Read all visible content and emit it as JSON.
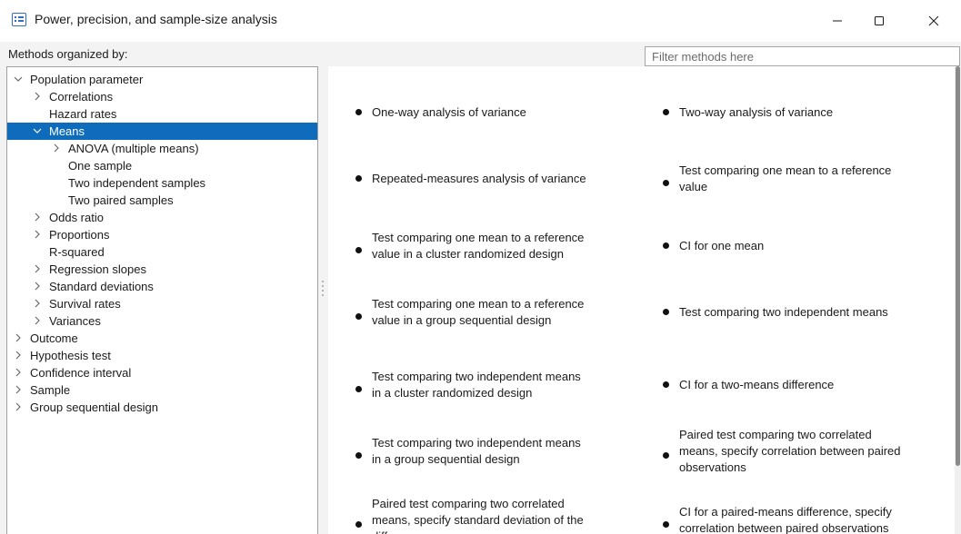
{
  "window": {
    "title": "Power, precision, and sample-size analysis",
    "app_icon": "window-list-icon"
  },
  "header": {
    "methods_label": "Methods organized by:",
    "filter_placeholder": "Filter methods here",
    "filter_value": ""
  },
  "tree": {
    "items": [
      {
        "label": "Population parameter",
        "state": "expanded"
      },
      {
        "label": "Correlations",
        "state": "collapsed"
      },
      {
        "label": "Hazard rates",
        "state": "leaf"
      },
      {
        "label": "Means",
        "state": "expanded",
        "selected": true
      },
      {
        "label": "ANOVA (multiple means)",
        "state": "collapsed"
      },
      {
        "label": "One sample",
        "state": "leaf"
      },
      {
        "label": "Two independent samples",
        "state": "leaf"
      },
      {
        "label": "Two paired samples",
        "state": "leaf"
      },
      {
        "label": "Odds ratio",
        "state": "collapsed"
      },
      {
        "label": "Proportions",
        "state": "collapsed"
      },
      {
        "label": "R-squared",
        "state": "leaf"
      },
      {
        "label": "Regression slopes",
        "state": "collapsed"
      },
      {
        "label": "Standard deviations",
        "state": "collapsed"
      },
      {
        "label": "Survival rates",
        "state": "collapsed"
      },
      {
        "label": "Variances",
        "state": "collapsed"
      },
      {
        "label": "Outcome",
        "state": "collapsed"
      },
      {
        "label": "Hypothesis test",
        "state": "collapsed"
      },
      {
        "label": "Confidence interval",
        "state": "collapsed"
      },
      {
        "label": "Sample",
        "state": "collapsed"
      },
      {
        "label": "Group sequential design",
        "state": "collapsed"
      }
    ]
  },
  "methods": [
    {
      "lines": [
        "One-way analysis of variance"
      ]
    },
    {
      "lines": [
        "Two-way analysis of variance"
      ]
    },
    {
      "lines": [
        "Repeated-measures analysis of variance"
      ]
    },
    {
      "lines": [
        "Test comparing one mean to a reference",
        "value"
      ]
    },
    {
      "lines": [
        "Test comparing one mean to a reference",
        "value in a cluster randomized design"
      ]
    },
    {
      "lines": [
        "CI for one mean"
      ]
    },
    {
      "lines": [
        "Test comparing one mean to a reference",
        "value in a group sequential design"
      ]
    },
    {
      "lines": [
        "Test comparing two independent means"
      ]
    },
    {
      "lines": [
        "Test comparing two independent means",
        "in a cluster randomized design"
      ]
    },
    {
      "lines": [
        "CI for a two-means difference"
      ]
    },
    {
      "lines": [
        "Test comparing two independent means",
        "in a group sequential design"
      ]
    },
    {
      "lines": [
        "Paired test comparing two correlated",
        "means, specify correlation between paired",
        "observations"
      ]
    },
    {
      "lines": [
        "Paired test comparing two correlated",
        "means, specify standard deviation of the",
        "diff"
      ]
    },
    {
      "lines": [
        "CI for a paired-means difference, specify",
        "correlation between paired observations"
      ]
    }
  ],
  "colors": {
    "selection": "#0f6cbd",
    "window_bg": "#f3f3f3",
    "panel_bg": "#ffffff"
  }
}
